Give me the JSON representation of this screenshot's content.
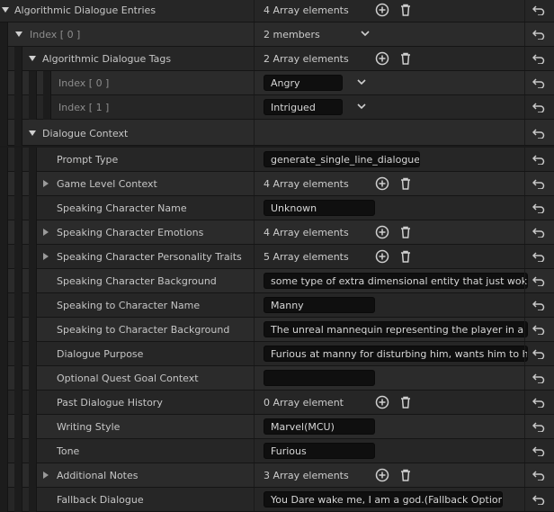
{
  "rows": [
    {
      "label": "Algorithmic Dialogue Entries",
      "value": "4 Array elements"
    },
    {
      "label": "Index [ 0 ]",
      "value": "2 members"
    },
    {
      "label": "Algorithmic Dialogue Tags",
      "value": "2 Array elements"
    },
    {
      "label": "Index [ 0 ]",
      "value": "Angry"
    },
    {
      "label": "Index [ 1 ]",
      "value": "Intrigued"
    },
    {
      "label": "Dialogue Context",
      "value": ""
    },
    {
      "label": "Prompt Type",
      "value": "generate_single_line_dialogue"
    },
    {
      "label": "Game Level Context",
      "value": "4 Array elements"
    },
    {
      "label": "Speaking Character Name",
      "value": "Unknown"
    },
    {
      "label": "Speaking Character Emotions",
      "value": "4 Array elements"
    },
    {
      "label": "Speaking Character Personality Traits",
      "value": "5 Array elements"
    },
    {
      "label": "Speaking Character Background",
      "value": "some type of extra dimensional entity that just woke u"
    },
    {
      "label": "Speaking to Character Name",
      "value": "Manny"
    },
    {
      "label": "Speaking to Character Background",
      "value": "The unreal mannequin representing the player in a gar"
    },
    {
      "label": "Dialogue Purpose",
      "value": "Furious at manny for disturbing him, wants him to harı"
    },
    {
      "label": "Optional Quest Goal Context",
      "value": ""
    },
    {
      "label": "Past Dialogue History",
      "value": "0 Array element"
    },
    {
      "label": "Writing Style",
      "value": "Marvel(MCU)"
    },
    {
      "label": "Tone",
      "value": "Furious"
    },
    {
      "label": "Additional Notes",
      "value": "3 Array elements"
    },
    {
      "label": "Fallback Dialogue",
      "value": "You Dare wake me, I am a god.(Fallback Option)"
    }
  ]
}
